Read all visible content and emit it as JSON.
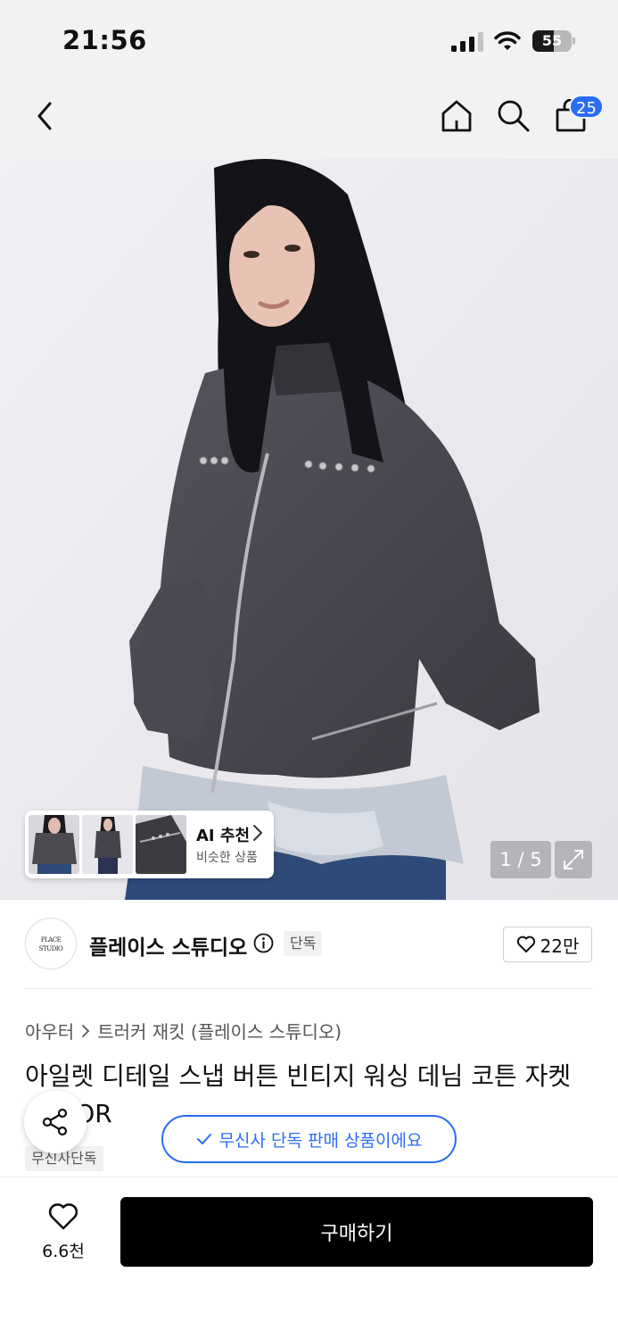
{
  "status_bar": {
    "time": "21:56",
    "battery": "55",
    "battery_level": 0.55
  },
  "nav": {
    "cart_count": "25"
  },
  "gallery": {
    "pager": "1 / 5",
    "ai_title": "AI 추천",
    "ai_subtitle": "비슷한 상품"
  },
  "brand": {
    "logo_text": "PLACE STUDIO",
    "name": "플레이스 스튜디오",
    "exclusive_tag": "단독",
    "like_count": "22만"
  },
  "breadcrumb": {
    "category": "아우터",
    "subcategory": "트러커 재킷 (플레이스 스튜디오)"
  },
  "product": {
    "title": "아일렛 디테일 스냅 버튼 빈티지 워싱 데님 코튼 자켓 COLOR",
    "tag": "무신사단독"
  },
  "toast": {
    "message": "무신사 단독 판매 상품이에요"
  },
  "bottom": {
    "wish_count": "6.6천",
    "buy_label": "구매하기"
  },
  "colors": {
    "accent": "#2b6cf5",
    "buy_bg": "#000000"
  }
}
